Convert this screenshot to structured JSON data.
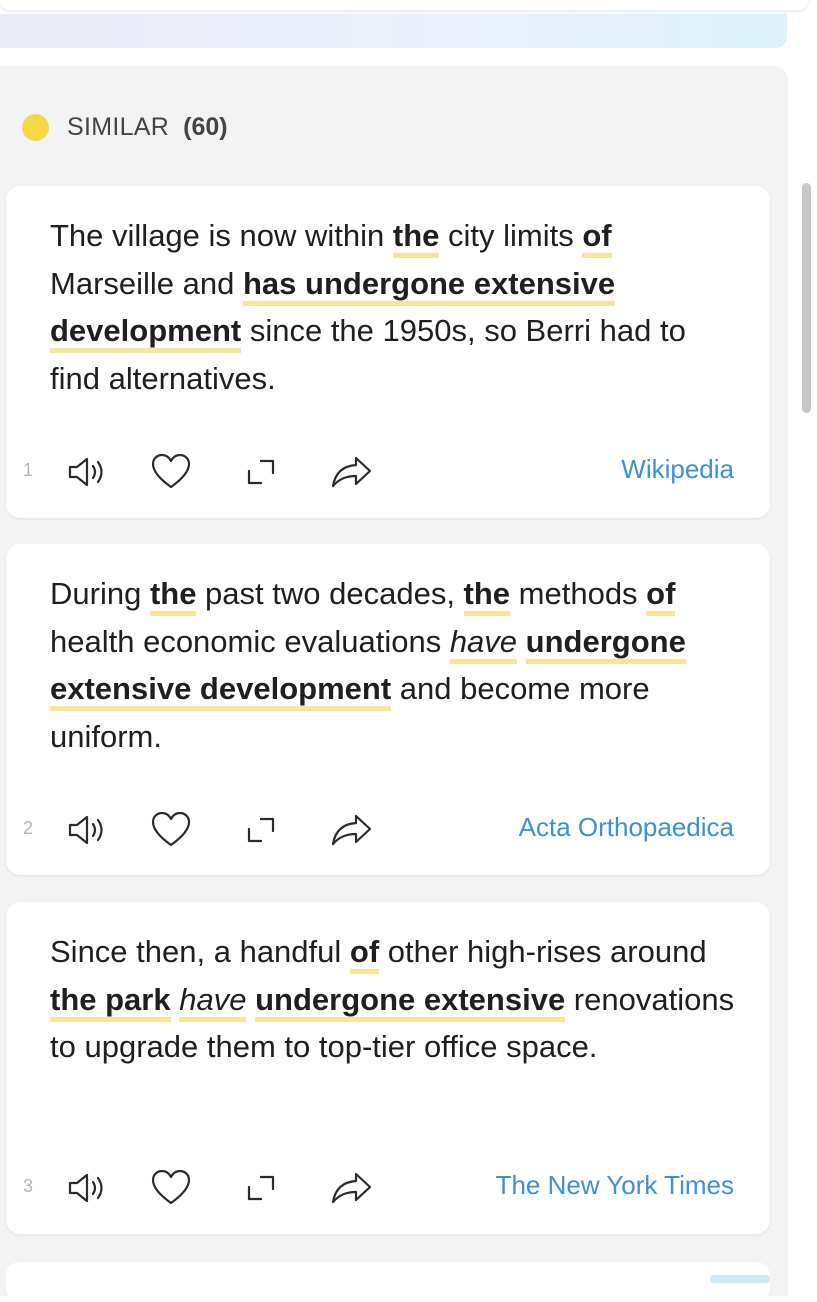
{
  "section": {
    "label": "SIMILAR",
    "count": "(60)",
    "dot_color": "#f5d84a"
  },
  "cards": [
    {
      "index": "1",
      "source": "Wikipedia",
      "parts": [
        "The village is now within ",
        "the",
        " city limits ",
        "of",
        " Marseille and ",
        "has undergone extensive development",
        " since the 1950s, so Berri had to find alternatives."
      ]
    },
    {
      "index": "2",
      "source": "Acta Orthopaedica",
      "parts": [
        "During ",
        "the",
        " past two decades, ",
        "the",
        " methods ",
        "of",
        " health economic evaluations ",
        "have",
        " ",
        "undergone extensive development",
        " and become more uniform."
      ]
    },
    {
      "index": "3",
      "source": "The New York Times",
      "parts": [
        "Since then, a handful ",
        "of",
        " other high-rises around ",
        "the park",
        " ",
        "have",
        " ",
        "undergone extensive",
        " renovations to upgrade them to top-tier office space."
      ]
    }
  ],
  "icons": [
    "speaker-icon",
    "heart-icon",
    "expand-icon",
    "share-icon"
  ],
  "colors": {
    "highlight": "#f7e59a",
    "source_link": "#3d8fd7",
    "panel_bg": "#f3f3f3"
  }
}
